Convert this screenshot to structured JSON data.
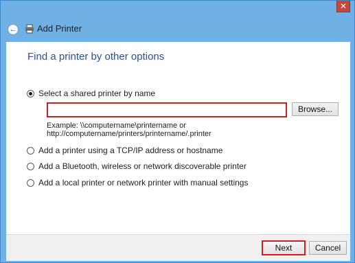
{
  "window": {
    "title": "Add Printer",
    "close_symbol": "✕"
  },
  "heading": "Find a printer by other options",
  "options": [
    {
      "label": "Select a shared printer by name",
      "checked": true
    },
    {
      "label": "Add a printer using a TCP/IP address or hostname",
      "checked": false
    },
    {
      "label": "Add a Bluetooth, wireless or network discoverable printer",
      "checked": false
    },
    {
      "label": "Add a local printer or network printer with manual settings",
      "checked": false
    }
  ],
  "shared_printer": {
    "value": "",
    "browse_label": "Browse...",
    "example_line1": "Example: \\\\computername\\printername or",
    "example_line2": "http://computername/printers/printername/.printer"
  },
  "footer": {
    "next_label": "Next",
    "cancel_label": "Cancel"
  },
  "icons": {
    "back": "back-arrow-icon",
    "printer": "printer-icon",
    "close": "close-icon"
  }
}
